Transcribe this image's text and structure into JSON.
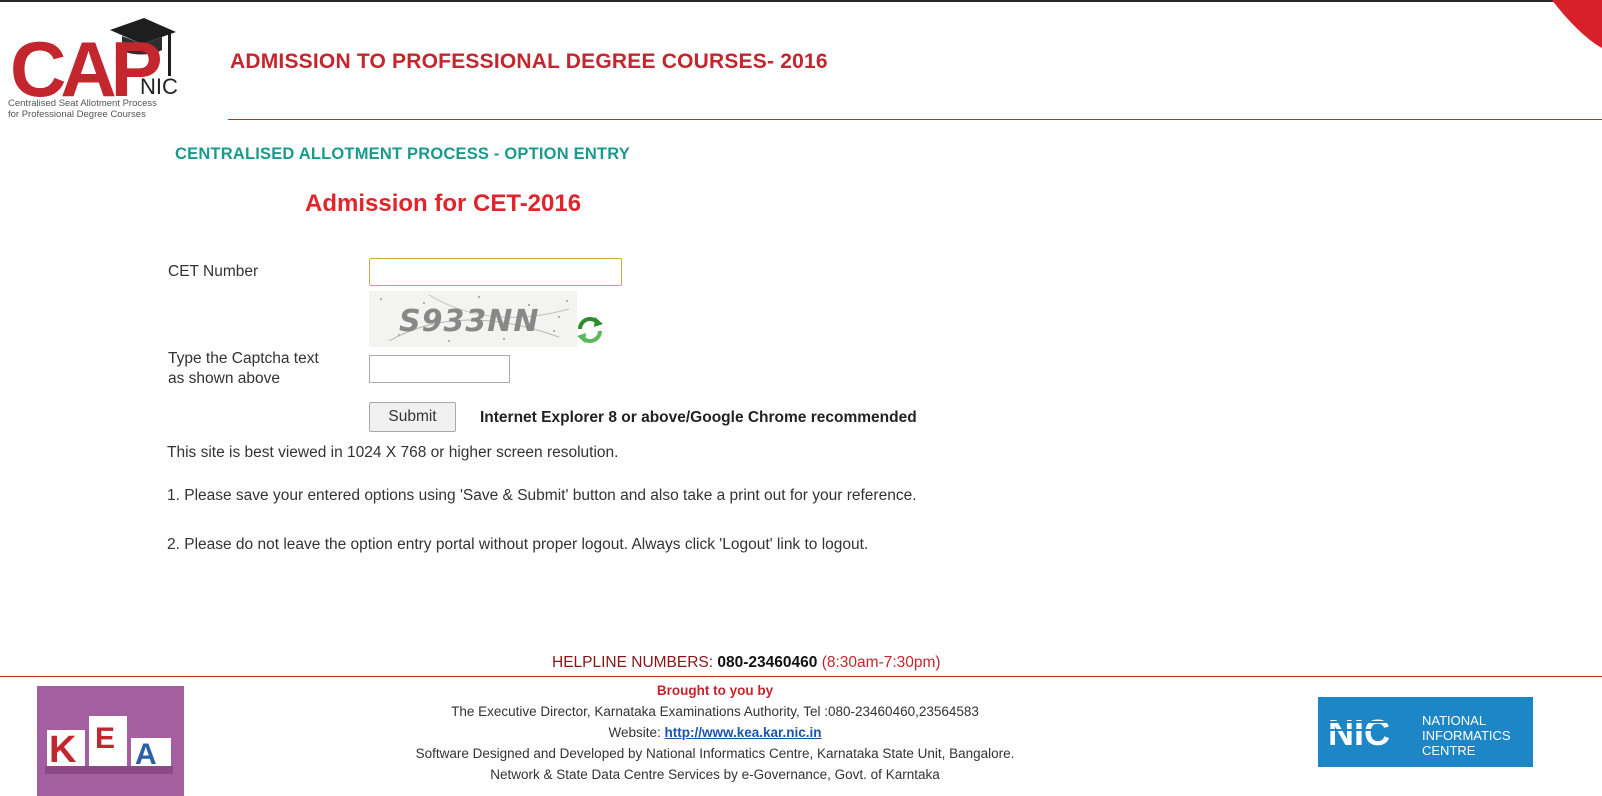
{
  "header": {
    "logo_cap": "CAP",
    "logo_nic": "NIC",
    "logo_sub_line1": "Centralised Seat Allotment Process",
    "logo_sub_line2": "for Professional Degree Courses",
    "title": "ADMISSION TO PROFESSIONAL DEGREE COURSES- 2016"
  },
  "section_title": "CENTRALISED ALLOTMENT PROCESS - OPTION ENTRY",
  "admission_title": "Admission for CET-2016",
  "form": {
    "cet_label": "CET Number",
    "cet_value": "",
    "captcha_text": "S933NN",
    "captcha_label_line1": "Type the Captcha text",
    "captcha_label_line2": "as shown above",
    "captcha_value": "",
    "submit_label": "Submit",
    "browser_note": "Internet Explorer 8 or above/Google Chrome recommended"
  },
  "info": {
    "resolution": "This site is best viewed in 1024 X 768 or higher screen resolution.",
    "note1": "1. Please save your entered options using 'Save & Submit' button and also take a print out for your reference.",
    "note2": "2. Please do not leave the option entry portal without proper logout. Always click 'Logout' link to logout."
  },
  "footer": {
    "helpline_label": "HELPLINE NUMBERS:",
    "helpline_number": "080-23460460",
    "helpline_hours": "(8:30am-7:30pm)",
    "brought": "Brought to you by",
    "line1": "The Executive Director, Karnataka Examinations Authority, Tel :080-23460460,23564583",
    "website_label": "Website:",
    "website_url": "http://www.kea.kar.nic.in",
    "line3": "Software Designed and Developed by National Informatics Centre, Karnataka State Unit, Bangalore.",
    "line4": "Network & State Data Centre Services by e-Governance, Govt. of Karntaka",
    "kea_letters": [
      "K",
      "E",
      "A"
    ],
    "nic_mark": "NIC",
    "nic_text": [
      "NATIONAL",
      "INFORMATICS",
      "CENTRE"
    ]
  },
  "colors": {
    "brand_red": "#c4262e",
    "teal": "#1a9a8c",
    "kea_purple": "#a45fa0",
    "nic_blue": "#1d86c6"
  }
}
